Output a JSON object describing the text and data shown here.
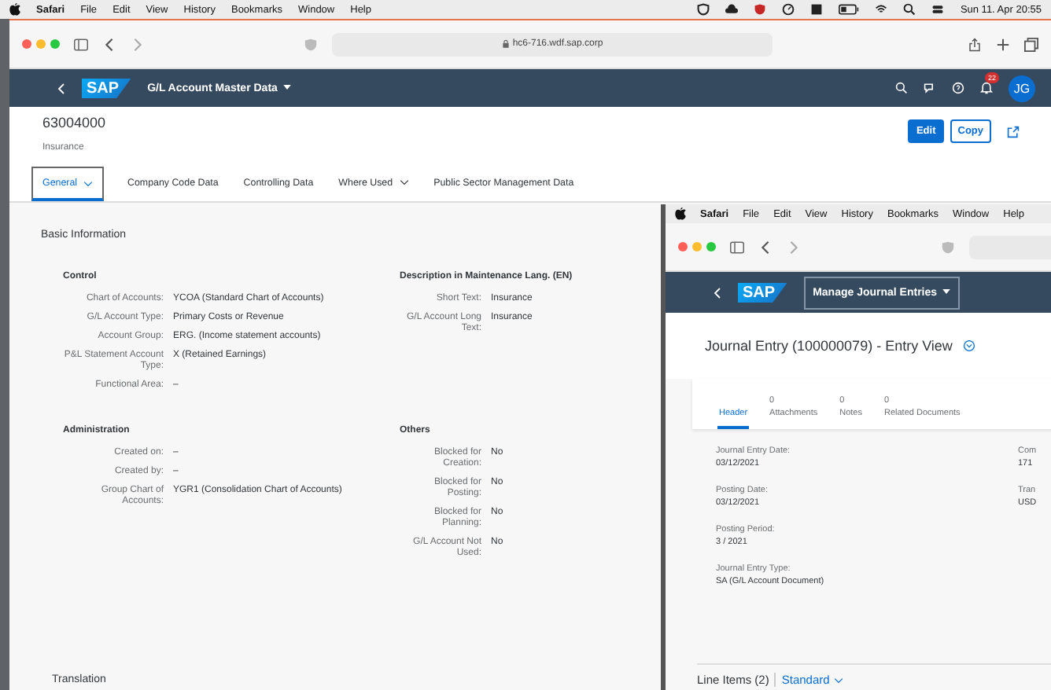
{
  "menubar": {
    "app": "Safari",
    "items": [
      "File",
      "Edit",
      "View",
      "History",
      "Bookmarks",
      "Window",
      "Help"
    ],
    "clock": "Sun 11. Apr  20:55"
  },
  "browser": {
    "url": "hc6-716.wdf.sap.corp"
  },
  "shell": {
    "logo": "SAP",
    "title": "G/L Account Master Data",
    "notification_count": "22",
    "avatar": "JG"
  },
  "header": {
    "title": "63004000",
    "subtitle": "Insurance",
    "actions": [
      {
        "label": "Edit",
        "emphasized": true
      },
      {
        "label": "Copy",
        "emphasized": false
      }
    ]
  },
  "tabs": [
    {
      "label": "General",
      "dropdown": true,
      "selected": true
    },
    {
      "label": "Company Code Data",
      "dropdown": false,
      "selected": false
    },
    {
      "label": "Controlling Data",
      "dropdown": false,
      "selected": false
    },
    {
      "label": "Where Used",
      "dropdown": true,
      "selected": false
    },
    {
      "label": "Public Sector Management Data",
      "dropdown": false,
      "selected": false
    }
  ],
  "section": {
    "title": "Basic Information",
    "groups": [
      {
        "title": "Control",
        "fields": [
          {
            "label": "Chart of Accounts:",
            "value": "YCOA (Standard Chart of Accounts)"
          },
          {
            "label": "G/L Account Type:",
            "value": "Primary Costs or Revenue"
          },
          {
            "label": "Account Group:",
            "value": "ERG. (Income statement accounts)"
          },
          {
            "label": "P&L Statement Account Type:",
            "value": "X (Retained Earnings)"
          },
          {
            "label": "Functional Area:",
            "value": "–"
          }
        ]
      },
      {
        "title": "Description in Maintenance Lang. (EN)",
        "fields": [
          {
            "label": "Short Text:",
            "value": "Insurance"
          },
          {
            "label": "G/L Account Long Text:",
            "value": "Insurance"
          }
        ]
      },
      {
        "title": "Administration",
        "fields": [
          {
            "label": "Created on:",
            "value": "–"
          },
          {
            "label": "Created by:",
            "value": "–"
          },
          {
            "label": "Group Chart of Accounts:",
            "value": "YGR1 (Consolidation Chart of Accounts)"
          }
        ]
      },
      {
        "title": "Others",
        "fields": [
          {
            "label": "Blocked for Creation:",
            "value": "No"
          },
          {
            "label": "Blocked for Posting:",
            "value": "No"
          },
          {
            "label": "Blocked for Planning:",
            "value": "No"
          },
          {
            "label": "G/L Account Not Used:",
            "value": "No"
          }
        ]
      }
    ]
  },
  "next_section": "Translation",
  "second_window": {
    "menubar": {
      "app": "Safari",
      "items": [
        "File",
        "Edit",
        "View",
        "History",
        "Bookmarks",
        "Window",
        "Help"
      ]
    },
    "shell": {
      "logo": "SAP",
      "title": "Manage Journal Entries"
    },
    "title": "Journal Entry (100000079) - Entry View",
    "tabs": [
      {
        "label": "Header",
        "selected": true
      },
      {
        "count": "0",
        "label": "Attachments",
        "selected": false
      },
      {
        "count": "0",
        "label": "Notes",
        "selected": false
      },
      {
        "count": "0",
        "label": "Related Documents",
        "selected": false
      }
    ],
    "fields": [
      {
        "label": "Journal Entry Date:",
        "value": "03/12/2021"
      },
      {
        "label": "Posting Date:",
        "value": "03/12/2021"
      },
      {
        "label": "Posting Period:",
        "value": "3 / 2021"
      },
      {
        "label": "Journal Entry Type:",
        "value": "SA (G/L Account Document)"
      }
    ],
    "fields_right": [
      {
        "label": "Com",
        "value": "171"
      },
      {
        "label": "Tran",
        "value": "USD"
      }
    ],
    "table": {
      "title": "Line Items (2)",
      "variant": "Standard"
    }
  }
}
